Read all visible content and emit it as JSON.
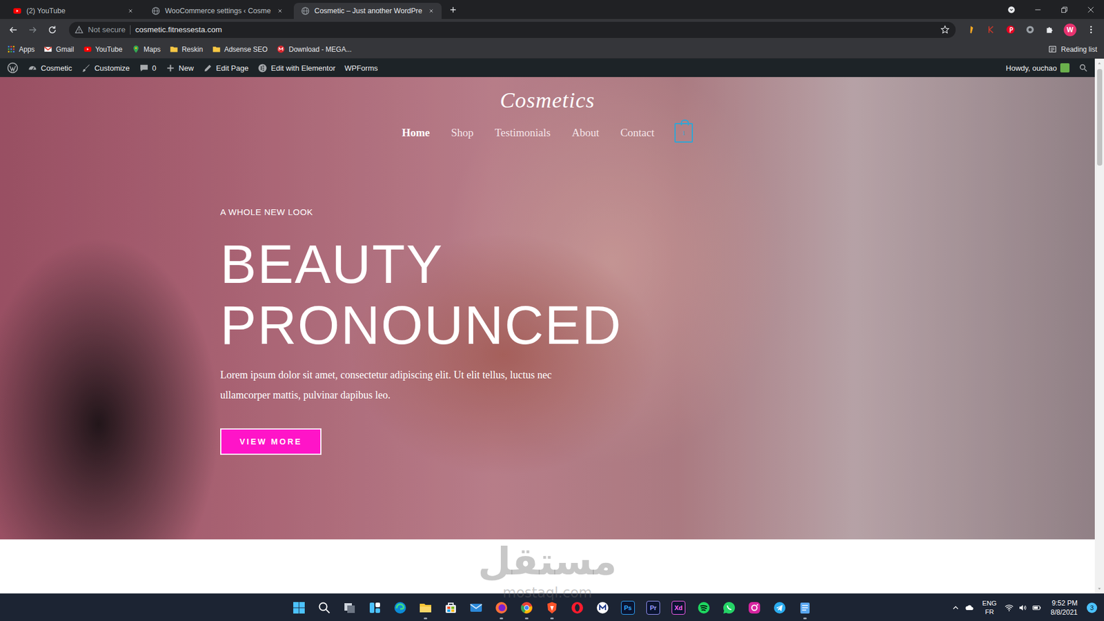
{
  "tabs": [
    {
      "label": "(2) YouTube",
      "kind": "youtube",
      "selected": false
    },
    {
      "label": "WooCommerce settings ‹ Cosme",
      "kind": "globe",
      "selected": false
    },
    {
      "label": "Cosmetic – Just another WordPre",
      "kind": "globe",
      "selected": true
    }
  ],
  "address_bar": {
    "security": "Not secure",
    "url": "cosmetic.fitnessesta.com"
  },
  "profile": {
    "initial": "W"
  },
  "bookmarks": [
    {
      "label": "Apps",
      "kind": "apps"
    },
    {
      "label": "Gmail",
      "kind": "gmail"
    },
    {
      "label": "YouTube",
      "kind": "youtube"
    },
    {
      "label": "Maps",
      "kind": "maps"
    },
    {
      "label": "Reskin",
      "kind": "folder"
    },
    {
      "label": "Adsense SEO",
      "kind": "folder"
    },
    {
      "label": "Download - MEGA...",
      "kind": "mega"
    }
  ],
  "reading_list": "Reading list",
  "admin_bar": {
    "items": [
      {
        "label": "Cosmetic",
        "kind": "dashboard"
      },
      {
        "label": "Customize",
        "kind": "brush"
      },
      {
        "label": "0",
        "kind": "comments"
      },
      {
        "label": "New",
        "kind": "plus"
      },
      {
        "label": "Edit Page",
        "kind": "pencil"
      },
      {
        "label": "Edit with Elementor",
        "kind": "elementor"
      },
      {
        "label": "WPForms",
        "kind": "plain"
      }
    ],
    "greeting": "Howdy, ouchao"
  },
  "site": {
    "logo": "Cosmetics",
    "nav": [
      {
        "label": "Home",
        "selected": true
      },
      {
        "label": "Shop",
        "selected": false
      },
      {
        "label": "Testimonials",
        "selected": false
      },
      {
        "label": "About",
        "selected": false
      },
      {
        "label": "Contact",
        "selected": false
      }
    ],
    "cart_count": "1",
    "eyebrow": "A WHOLE NEW LOOK",
    "headline": [
      "BEAUTY",
      "PRONOUNCED"
    ],
    "body": "Lorem ipsum dolor sit amet, consectetur adipiscing elit. Ut elit tellus, luctus nec ullamcorper mattis, pulvinar dapibus leo.",
    "cta": "VIEW MORE"
  },
  "watermark": {
    "arabic": "مستقل",
    "latin": "mostaql.com"
  },
  "taskbar": {
    "apps": [
      {
        "kind": "windows",
        "running": false
      },
      {
        "kind": "search",
        "running": false
      },
      {
        "kind": "taskview",
        "running": false
      },
      {
        "kind": "widgets",
        "running": false
      },
      {
        "kind": "edge",
        "running": false
      },
      {
        "kind": "explorer",
        "running": true
      },
      {
        "kind": "store",
        "running": false
      },
      {
        "kind": "mail",
        "running": false
      },
      {
        "kind": "firefox",
        "running": true
      },
      {
        "kind": "chrome",
        "running": true
      },
      {
        "kind": "brave",
        "running": true
      },
      {
        "kind": "opera",
        "running": false
      },
      {
        "kind": "circle",
        "running": false
      },
      {
        "kind": "text",
        "text": "Ps",
        "color": "#31a8ff",
        "running": false
      },
      {
        "kind": "text",
        "text": "Pr",
        "color": "#9999ff",
        "running": false
      },
      {
        "kind": "text",
        "text": "Xd",
        "color": "#ff61f6",
        "running": false
      },
      {
        "kind": "spotify",
        "running": false
      },
      {
        "kind": "whatsapp",
        "running": false
      },
      {
        "kind": "instagram",
        "running": false
      },
      {
        "kind": "telegram",
        "running": false
      },
      {
        "kind": "notepad",
        "running": true
      }
    ],
    "language": [
      "ENG",
      "FR"
    ],
    "time": "9:52 PM",
    "date": "8/8/2021",
    "notifications": "3"
  }
}
